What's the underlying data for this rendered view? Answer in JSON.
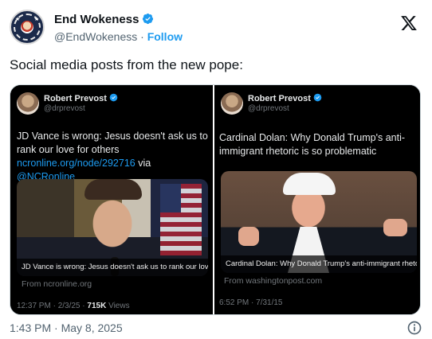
{
  "author": {
    "name": "End Wokeness",
    "handle": "@EndWokeness",
    "separator": "·",
    "follow_label": "Follow"
  },
  "tweet": {
    "text": "Social media posts from the new pope:",
    "timestamp": "1:43 PM · May 8, 2025"
  },
  "embedded_left": {
    "name": "Robert Prevost",
    "handle": "@drprevost",
    "text_plain": "JD Vance is wrong: Jesus doesn't ask us to rank our love for others ",
    "link_url": "ncronline.org/node/292716",
    "text_via": " via ",
    "link_mention": "@NCRonline",
    "image_caption": "JD Vance is wrong: Jesus doesn't ask us to rank our love for...",
    "source": "From ncronline.org",
    "time": "12:37 PM · 2/3/25 · ",
    "views_count": "715K",
    "views_label": " Views"
  },
  "embedded_right": {
    "name": "Robert Prevost",
    "handle": "@drprevost",
    "text": "Cardinal Dolan: Why Donald Trump's anti-immigrant rhetoric is so problematic",
    "image_caption": "Cardinal Dolan: Why Donald Trump's anti-immigrant rhetor...",
    "source": "From washingtonpost.com",
    "time": "6:52 PM · 7/31/15"
  },
  "colors": {
    "accent": "#1d9bf0",
    "text": "#0f1419",
    "secondary": "#536471"
  },
  "icons": [
    "verified-badge-icon",
    "x-logo-icon",
    "info-icon"
  ]
}
